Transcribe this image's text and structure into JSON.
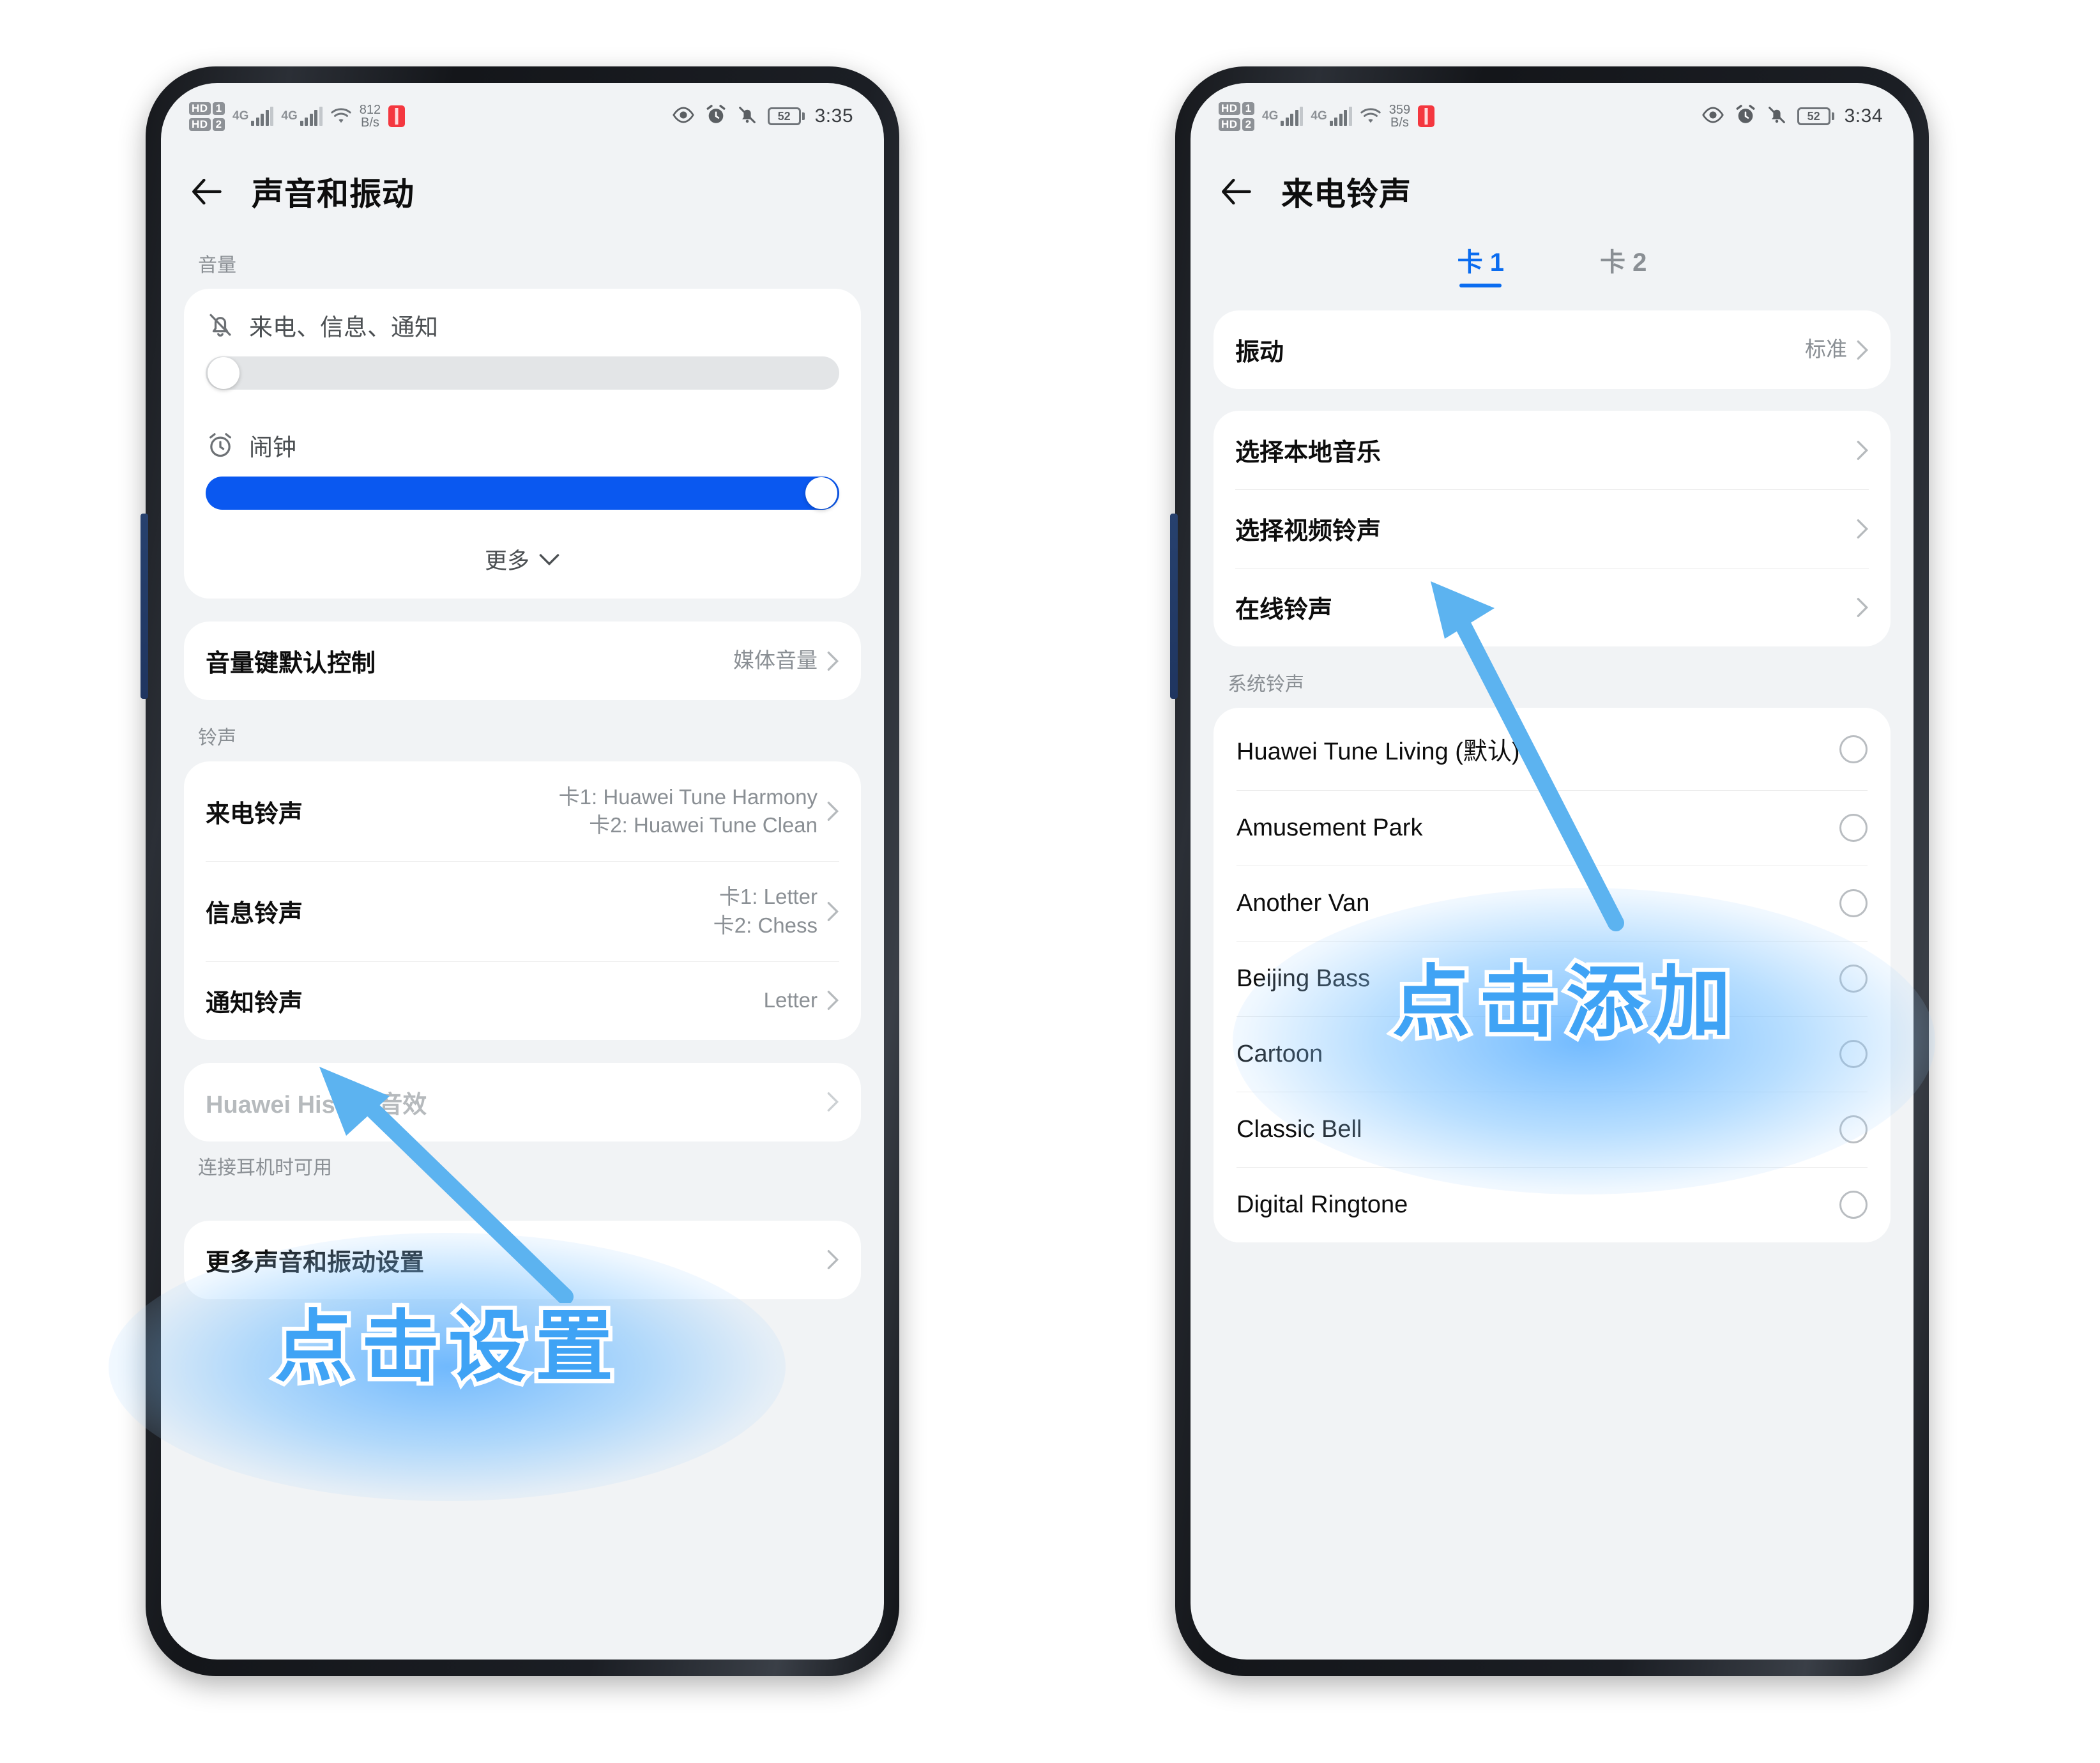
{
  "phones": [
    {
      "id": "sound-and-vibration",
      "statusbar": {
        "hd1": "HD",
        "sim1": "1",
        "hd2": "HD",
        "sim2": "2",
        "net1": "4G",
        "net2": "4G",
        "speed_value": "812",
        "speed_unit": "B/s",
        "battery": "52",
        "time": "3:35"
      },
      "header": {
        "title": "声音和振动"
      },
      "sections": {
        "volume_label": "音量",
        "ringtone_label": "铃声"
      },
      "volume": {
        "sliders": [
          {
            "label": "来电、信息、通知",
            "icon": "bell-off-icon",
            "level": 0
          },
          {
            "label": "闹钟",
            "icon": "alarm-clock-icon",
            "level": 100
          }
        ],
        "more_label": "更多"
      },
      "volume_key": {
        "title": "音量键默认控制",
        "value": "媒体音量"
      },
      "ringtone_rows": [
        {
          "title": "来电铃声",
          "value": "卡1: Huawei Tune Harmony\n卡2: Huawei Tune Clean"
        },
        {
          "title": "信息铃声",
          "value": "卡1: Letter\n卡2: Chess"
        },
        {
          "title": "通知铃声",
          "value": "Letter"
        }
      ],
      "histen": {
        "title": "Huawei Histen 音效",
        "subtitle": "连接耳机时可用"
      },
      "more_settings": {
        "title": "更多声音和振动设置"
      },
      "annotation": {
        "text": "点击设置"
      }
    },
    {
      "id": "incoming-call-ringtone",
      "statusbar": {
        "hd1": "HD",
        "sim1": "1",
        "hd2": "HD",
        "sim2": "2",
        "net1": "4G",
        "net2": "4G",
        "speed_value": "359",
        "speed_unit": "B/s",
        "battery": "52",
        "time": "3:34"
      },
      "header": {
        "title": "来电铃声"
      },
      "tabs": [
        {
          "label": "卡 1",
          "active": true
        },
        {
          "label": "卡 2",
          "active": false
        }
      ],
      "vibration": {
        "title": "振动",
        "value": "标准"
      },
      "sources": [
        {
          "title": "选择本地音乐"
        },
        {
          "title": "选择视频铃声"
        },
        {
          "title": "在线铃声"
        }
      ],
      "system_label": "系统铃声",
      "tones": [
        {
          "name": "Huawei Tune Living (默认)",
          "selected": false
        },
        {
          "name": "Amusement Park",
          "selected": false
        },
        {
          "name": "Another Van",
          "selected": false
        },
        {
          "name": "Beijing Bass",
          "selected": false
        },
        {
          "name": "Cartoon",
          "selected": false
        },
        {
          "name": "Classic Bell",
          "selected": false
        },
        {
          "name": "Digital Ringtone",
          "selected": false
        }
      ],
      "annotation": {
        "text": "点击添加"
      }
    }
  ],
  "colors": {
    "accent_blue": "#0a58f0",
    "tab_blue": "#0a6cf0",
    "annotation_blue": "#3fa3f5",
    "arrow_blue": "#5cb3f0",
    "status_red": "#f4373f"
  }
}
